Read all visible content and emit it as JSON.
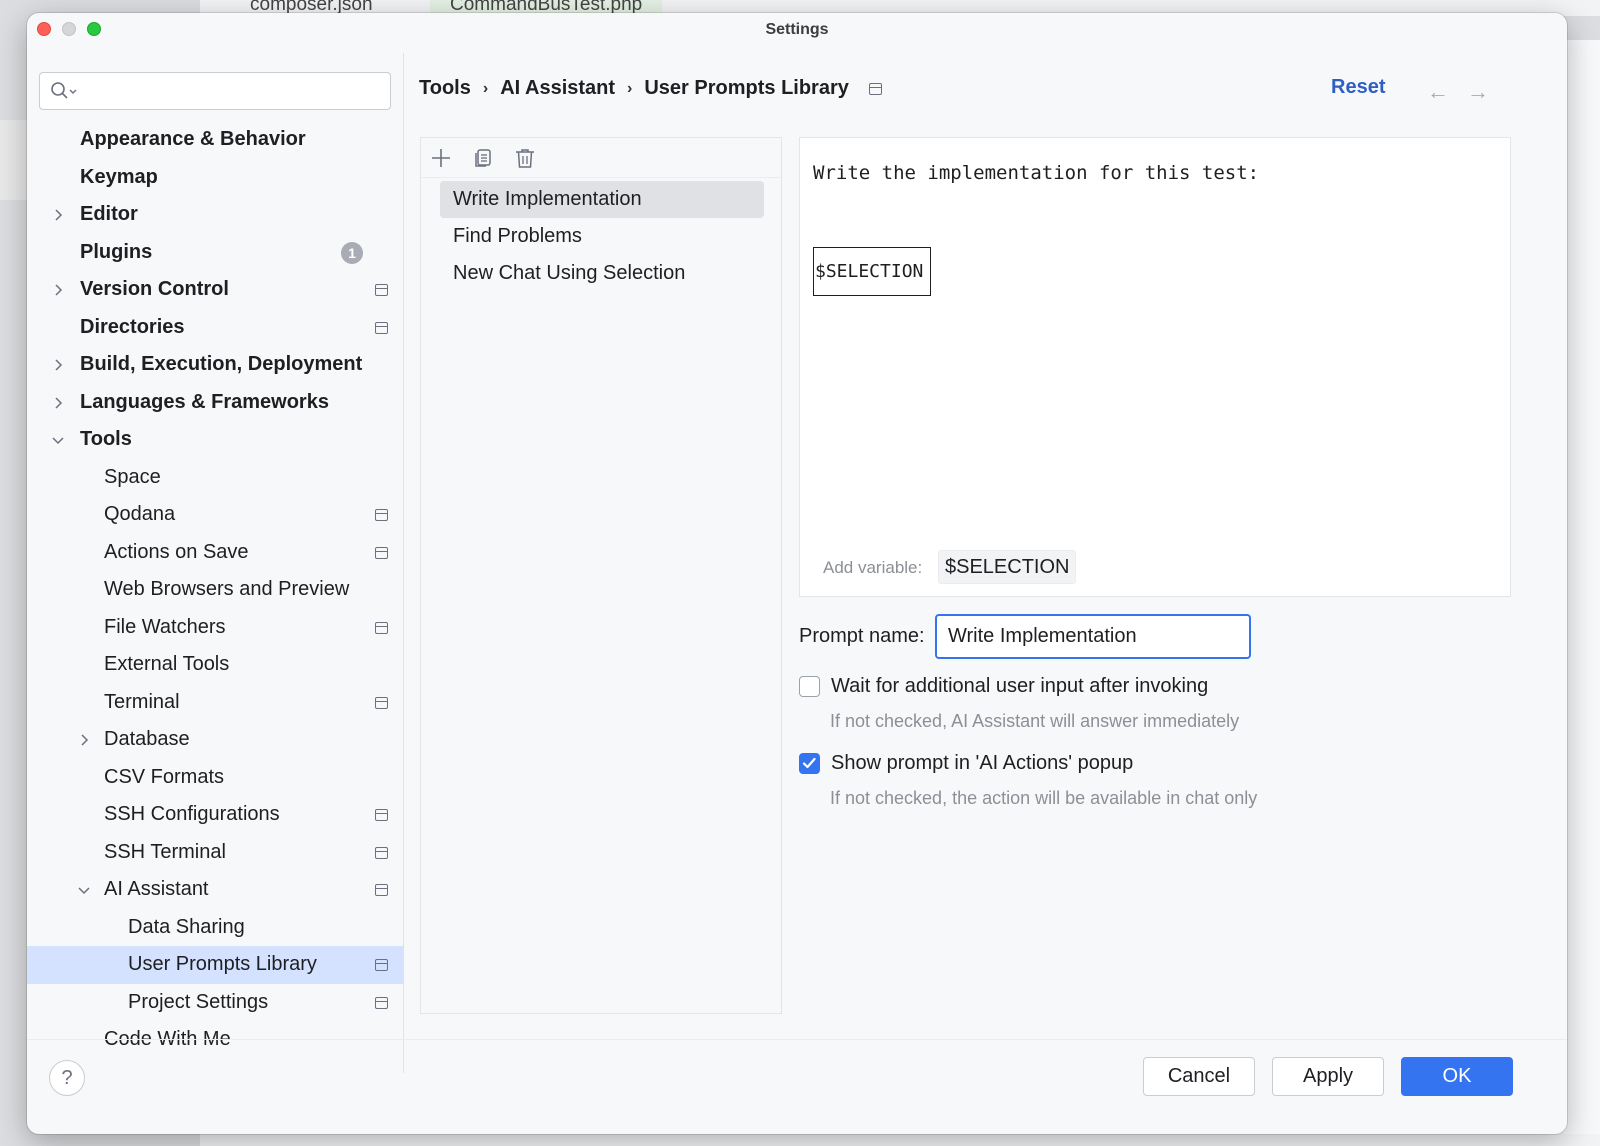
{
  "background": {
    "tabs": [
      {
        "label": "composer.json"
      },
      {
        "label": "CommandBusTest.php"
      }
    ]
  },
  "window": {
    "title": "Settings"
  },
  "sidebar": {
    "search": {
      "value": "",
      "placeholder": ""
    },
    "items": [
      {
        "label": "Appearance & Behavior"
      },
      {
        "label": "Keymap"
      },
      {
        "label": "Editor"
      },
      {
        "label": "Plugins",
        "badge": "1"
      },
      {
        "label": "Version Control"
      },
      {
        "label": "Directories"
      },
      {
        "label": "Build, Execution, Deployment"
      },
      {
        "label": "Languages & Frameworks"
      },
      {
        "label": "Tools"
      },
      {
        "label": "Space"
      },
      {
        "label": "Qodana"
      },
      {
        "label": "Actions on Save"
      },
      {
        "label": "Web Browsers and Preview"
      },
      {
        "label": "File Watchers"
      },
      {
        "label": "External Tools"
      },
      {
        "label": "Terminal"
      },
      {
        "label": "Database"
      },
      {
        "label": "CSV Formats"
      },
      {
        "label": "SSH Configurations"
      },
      {
        "label": "SSH Terminal"
      },
      {
        "label": "AI Assistant"
      },
      {
        "label": "Data Sharing"
      },
      {
        "label": "User Prompts Library"
      },
      {
        "label": "Project Settings"
      },
      {
        "label": "Code With Me"
      }
    ]
  },
  "breadcrumb": {
    "items": [
      "Tools",
      "AI Assistant",
      "User Prompts Library"
    ],
    "separator": "›"
  },
  "header": {
    "reset_label": "Reset",
    "back_arrow": "←",
    "forward_arrow": "→"
  },
  "prompts": {
    "items": [
      {
        "label": "Write Implementation"
      },
      {
        "label": "Find Problems"
      },
      {
        "label": "New Chat Using Selection"
      }
    ]
  },
  "editor": {
    "text": "Write the implementation for this test:",
    "variable": "$SELECTION",
    "add_variable_label": "Add variable:",
    "add_variable_chip": "$SELECTION"
  },
  "form": {
    "prompt_name_label": "Prompt name:",
    "prompt_name_value": "Write Implementation",
    "wait_label": "Wait for additional user input after invoking",
    "wait_hint": "If not checked, AI Assistant will answer immediately",
    "show_label": "Show prompt in 'AI Actions' popup",
    "show_hint": "If not checked, the action will be available in chat only"
  },
  "footer": {
    "help_label": "?",
    "cancel_label": "Cancel",
    "apply_label": "Apply",
    "ok_label": "OK"
  },
  "colors": {
    "accent": "#3574f0",
    "link": "#2f5fc4",
    "selection": "#d4e2ff"
  }
}
